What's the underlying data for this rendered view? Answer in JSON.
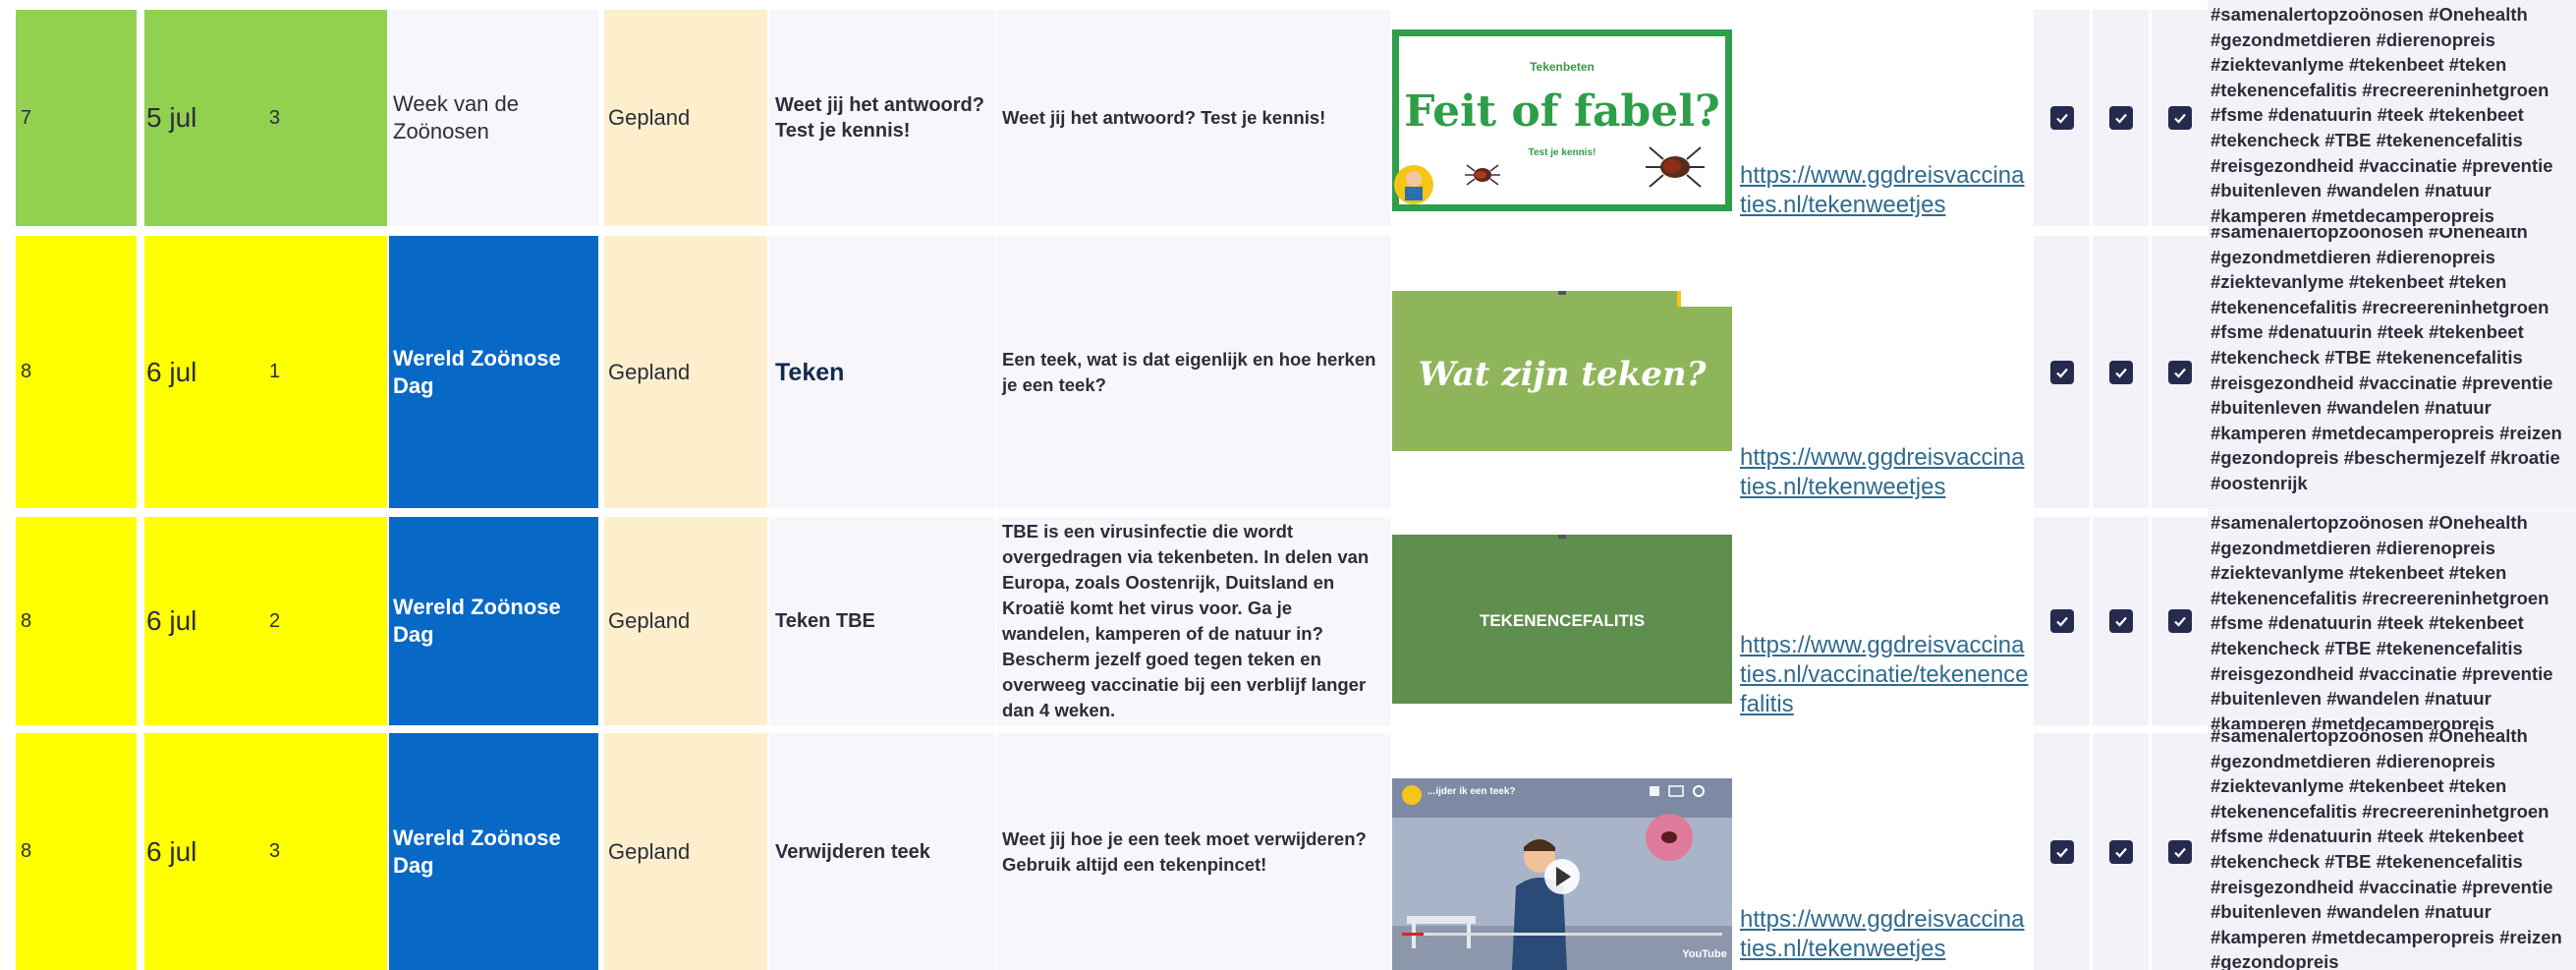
{
  "colors": {
    "green": "#92d050",
    "yellow": "#ffff00",
    "event_blue": "#0768c6",
    "status_bg": "#fdefcc",
    "checkbox": "#262a4e",
    "link": "#2f6b8f"
  },
  "rows": [
    {
      "week": "7",
      "date": "5 jul",
      "num": "3",
      "event": "Week van de Zoönosen",
      "status": "Gepland",
      "title": "Weet jij het antwoord? Test je kennis!",
      "text": "Weet jij het antwoord? Test je kennis!",
      "image": {
        "kind": "fact-or-fable",
        "small_title": "Tekenbeten",
        "headline": "Feit of fabel?",
        "subtitle": "Test je kennis!"
      },
      "link": "https://www.ggdreisvaccinaties.nl/tekenweetjes",
      "checks": [
        true,
        true,
        true
      ],
      "hashtags": "#samenalertopzoönosen #Onehealth #gezondmetdieren #dierenopreis #ziektevanlyme #tekenbeet #teken #tekenencefalitis #recreereninhetgroen #fsme #denatuurin #teek #tekenbeet #tekencheck #TBE #tekenencefalitis #reisgezondheid #vaccinatie #preventie #buitenleven #wandelen #natuur #kamperen #metdecamperopreis"
    },
    {
      "week": "8",
      "date": "6 jul",
      "num": "1",
      "event": "Wereld Zoönose Dag",
      "status": "Gepland",
      "title": "Teken",
      "text": "Een teek, wat is dat eigenlijk en hoe herken je een teek?",
      "image": {
        "kind": "video-title",
        "headline": "Wat zijn teken?"
      },
      "link": "https://www.ggdreisvaccinaties.nl/tekenweetjes",
      "checks": [
        true,
        true,
        true
      ],
      "hashtags": "#samenalertopzoönosen #Onehealth #gezondmetdieren #dierenopreis #ziektevanlyme #tekenbeet #teken #tekenencefalitis #recreereninhetgroen #fsme #denatuurin #teek #tekenbeet #tekencheck #TBE #tekenencefalitis #reisgezondheid #vaccinatie #preventie #buitenleven #wandelen #natuur #kamperen #metdecamperopreis #reizen #gezondopreis #beschermjezelf #kroatie #oostenrijk"
    },
    {
      "week": "8",
      "date": "6 jul",
      "num": "2",
      "event": "Wereld Zoönose Dag",
      "status": "Gepland",
      "title": "Teken TBE",
      "text": "TBE is een virusinfectie die wordt overgedragen via tekenbeten. In delen van Europa, zoals Oostenrijk, Duitsland en Kroatië komt het virus voor. Ga je wandelen, kamperen of de natuur in? Bescherm jezelf goed tegen teken en overweeg vaccinatie bij een verblijf langer dan 4 weken.",
      "image": {
        "kind": "video-title",
        "headline": "TEKENENCEFALITIS"
      },
      "link": "https://www.ggdreisvaccinaties.nl/vaccinatie/tekenencefalitis",
      "checks": [
        true,
        true,
        true
      ],
      "hashtags": "#samenalertopzoönosen #Onehealth #gezondmetdieren #dierenopreis #ziektevanlyme #tekenbeet #teken #tekenencefalitis #recreereninhetgroen #fsme #denatuurin #teek #tekenbeet #tekencheck #TBE #tekenencefalitis #reisgezondheid #vaccinatie #preventie #buitenleven #wandelen #natuur #kamperen #metdecamperopreis"
    },
    {
      "week": "8",
      "date": "6 jul",
      "num": "3",
      "event": "Wereld Zoönose Dag",
      "status": "Gepland",
      "title": "Verwijderen teek",
      "text": "Weet jij hoe je een teek moet verwijderen? Gebruik altijd een tekenpincet!",
      "image": {
        "kind": "youtube-thumbnail",
        "video_title": "...ijder ik een teek?",
        "youtube_label": "YouTube"
      },
      "link": "https://www.ggdreisvaccinaties.nl/tekenweetjes",
      "checks": [
        true,
        true,
        true
      ],
      "hashtags": "#samenalertopzoönosen #Onehealth #gezondmetdieren #dierenopreis #ziektevanlyme #tekenbeet #teken #tekenencefalitis #recreereninhetgroen #fsme #denatuurin #teek #tekenbeet #tekencheck #TBE #tekenencefalitis #reisgezondheid #vaccinatie #preventie #buitenleven #wandelen #natuur #kamperen #metdecamperopreis #reizen #gezondopreis"
    }
  ]
}
